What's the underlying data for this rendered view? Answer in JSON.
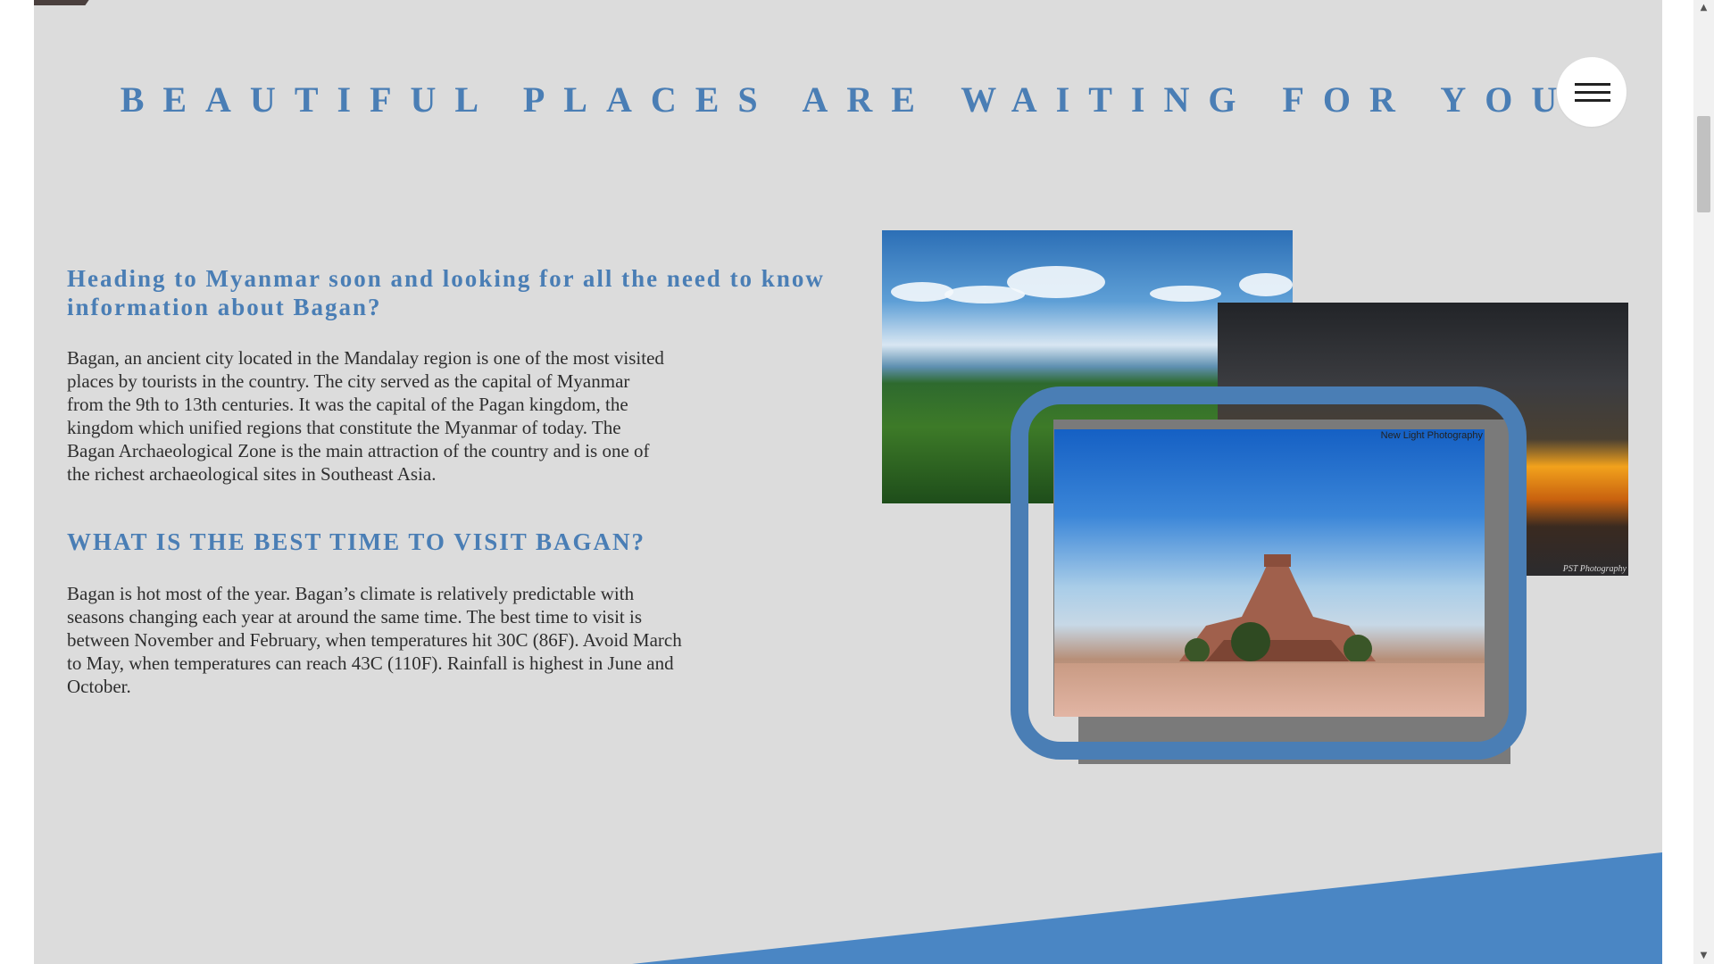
{
  "hero": {
    "title": "BEAUTIFUL PLACES ARE WAITING FOR YOU"
  },
  "menu": {
    "icon": "hamburger-menu-icon"
  },
  "intro": {
    "heading": "Heading to Myanmar soon and looking for all the need to know information about Bagan?",
    "text": "Bagan, an ancient city located in the Mandalay region is one of the most visited places by tourists in the country. The city served as the capital of Myanmar from the 9th to 13th centuries. It was the capital of the Pagan kingdom, the kingdom which unified regions that constitute the Myanmar of today. The Bagan Archaeological Zone is the main attraction of the country and is one of the richest archaeological sites in Southeast Asia."
  },
  "best_time": {
    "heading": "WHAT IS THE BEST TIME TO VISIT BAGAN?",
    "text": "Bagan is hot most of the year. Bagan’s climate is relatively predictable with seasons changing each year at around the same time. The best time to visit is between November and February, when temperatures hit 30C (86F). Avoid March to May, when temperatures can reach 43C (110F). Rainfall is highest in June and October."
  },
  "photos": {
    "sunset_credit": "PST Photography",
    "temple_credit": "New Light Photography"
  },
  "colors": {
    "accent": "#4a7eb5",
    "panel": "#dcdcdc",
    "wedge": "#4a86c4"
  },
  "scrollbar": {
    "up_icon": "scroll-up-arrow-icon",
    "down_icon": "scroll-down-arrow-icon"
  }
}
